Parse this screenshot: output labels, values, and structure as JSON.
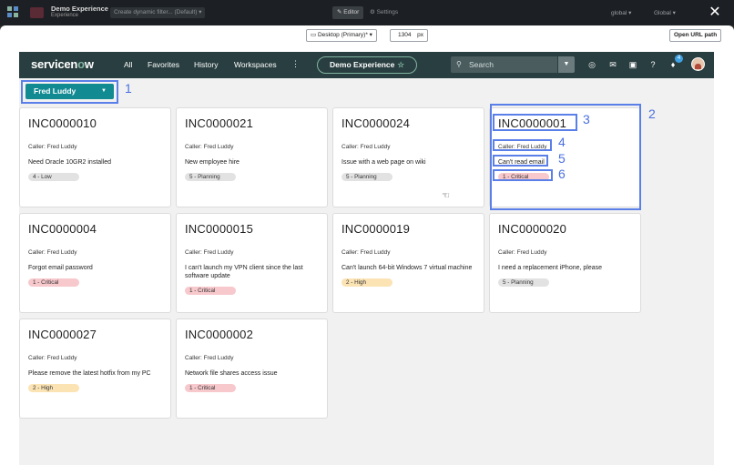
{
  "topbar": {
    "app_name": "Demo Experience",
    "app_sub": "Experience",
    "filter_label": "Create dynamic filter...  (Default) ▾",
    "editor_label": "✎ Editor",
    "settings_label": "⚙ Settings",
    "scope_a": "global ▾",
    "scope_b": "Global ▾",
    "close_label": "✕"
  },
  "devbar": {
    "device": "Desktop (Primary)* ▾",
    "width": "1304",
    "width_unit": "px",
    "open_url": "Open URL path"
  },
  "sn": {
    "logo_a": "servicen",
    "logo_o": "o",
    "logo_b": "w",
    "nav": [
      "All",
      "Favorites",
      "History",
      "Workspaces"
    ],
    "more": "⋮",
    "experience": "Demo Experience",
    "experience_star": "☆",
    "search_placeholder": "Search",
    "badge_count": "4"
  },
  "caller_dropdown": "Fred Luddy",
  "cards": [
    {
      "number": "INC0000010",
      "caller": "Caller: Fred Luddy",
      "desc": "Need Oracle 10GR2 installed",
      "priority": "4 - Low",
      "level": "low"
    },
    {
      "number": "INC0000021",
      "caller": "Caller: Fred Luddy",
      "desc": "New employee hire",
      "priority": "5 - Planning",
      "level": "planning"
    },
    {
      "number": "INC0000024",
      "caller": "Caller: Fred Luddy",
      "desc": "Issue with a web page on wiki",
      "priority": "5 - Planning",
      "level": "planning"
    },
    {
      "number": "INC0000001",
      "caller": "Caller: Fred Luddy",
      "desc": "Can't read email",
      "priority": "1 - Critical",
      "level": "critical"
    },
    {
      "number": "INC0000004",
      "caller": "Caller: Fred Luddy",
      "desc": "Forgot email password",
      "priority": "1 - Critical",
      "level": "critical"
    },
    {
      "number": "INC0000015",
      "caller": "Caller: Fred Luddy",
      "desc": "I can't launch my VPN client since the last software update",
      "priority": "1 - Critical",
      "level": "critical"
    },
    {
      "number": "INC0000019",
      "caller": "Caller: Fred Luddy",
      "desc": "Can't launch 64-bit Windows 7 virtual machine",
      "priority": "2 - High",
      "level": "high"
    },
    {
      "number": "INC0000020",
      "caller": "Caller: Fred Luddy",
      "desc": "I need a replacement iPhone, please",
      "priority": "5 - Planning",
      "level": "planning"
    },
    {
      "number": "INC0000027",
      "caller": "Caller: Fred Luddy",
      "desc": "Please remove the latest hotfix from my PC",
      "priority": "2 - High",
      "level": "high"
    },
    {
      "number": "INC0000002",
      "caller": "Caller: Fred Luddy",
      "desc": "Network file shares access issue",
      "priority": "1 - Critical",
      "level": "critical"
    }
  ],
  "annotations": [
    "1",
    "2",
    "3",
    "4",
    "5",
    "6"
  ]
}
